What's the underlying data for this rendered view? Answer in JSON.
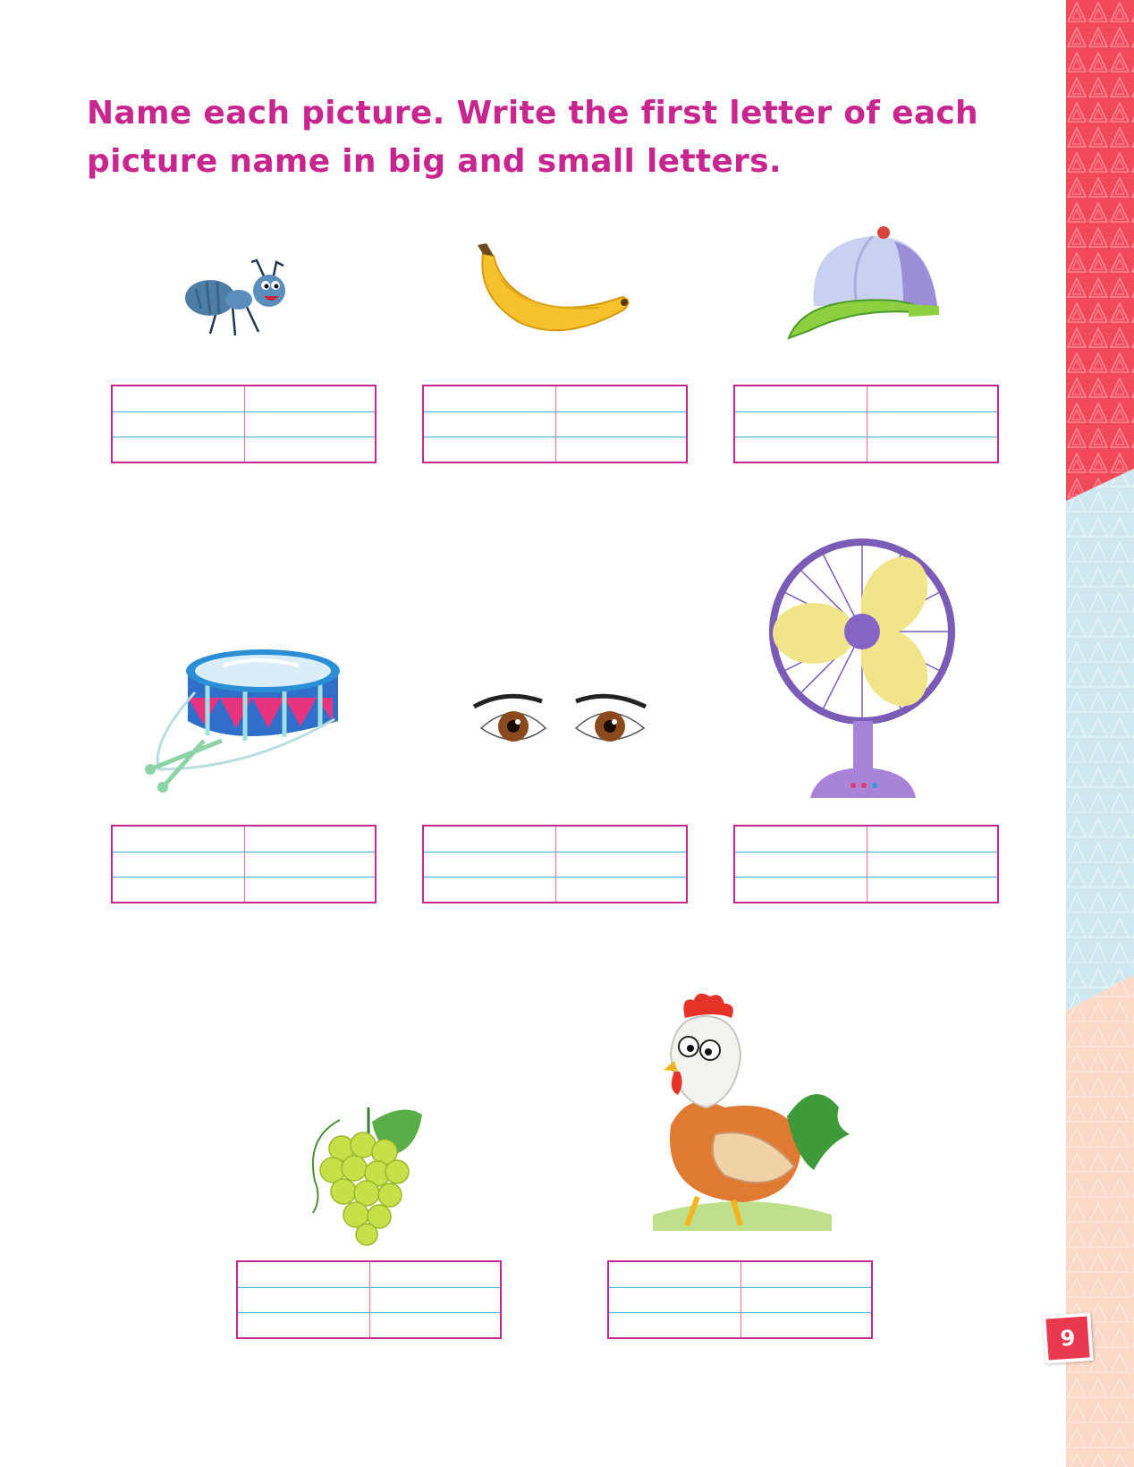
{
  "instruction": "Name each picture. Write the first letter of each picture name in big and small letters.",
  "page_number": "9",
  "pictures": [
    {
      "icon": "ant-icon"
    },
    {
      "icon": "banana-icon"
    },
    {
      "icon": "cap-icon"
    },
    {
      "icon": "drum-icon"
    },
    {
      "icon": "eyes-icon"
    },
    {
      "icon": "fan-icon"
    },
    {
      "icon": "grapes-icon"
    },
    {
      "icon": "hen-icon"
    }
  ],
  "colors": {
    "heading": "#c8268f",
    "box_border": "#c8268f",
    "ruling": "#35aee0",
    "band_top": "#f04a5a",
    "band_middle": "#cfe8f0",
    "band_bottom": "#fbd9c6"
  }
}
